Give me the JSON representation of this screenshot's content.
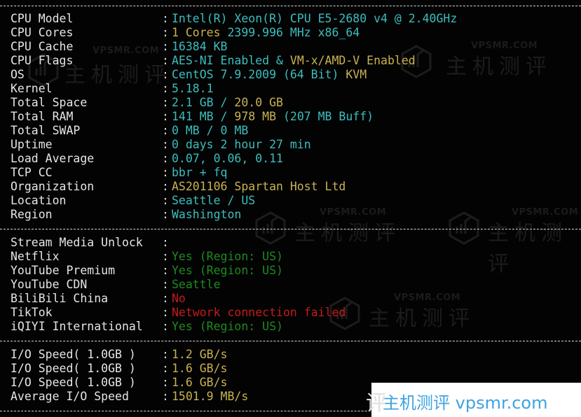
{
  "system_info": [
    {
      "label": "CPU Model",
      "segments": [
        {
          "text": "Intel(R) Xeon(R) CPU E5-2680 v4 @ 2.40GHz",
          "color": "cyan"
        }
      ]
    },
    {
      "label": "CPU Cores",
      "segments": [
        {
          "text": "1 Cores ",
          "color": "yellow"
        },
        {
          "text": "2399.996 MHz x86_64",
          "color": "cyan"
        }
      ]
    },
    {
      "label": "CPU Cache",
      "segments": [
        {
          "text": "16384 KB",
          "color": "cyan"
        }
      ]
    },
    {
      "label": "CPU Flags",
      "segments": [
        {
          "text": "AES-NI Enabled & ",
          "color": "cyan"
        },
        {
          "text": "VM-x/AMD-V Enabled",
          "color": "yellow"
        }
      ]
    },
    {
      "label": "OS",
      "segments": [
        {
          "text": "CentOS 7.9.2009 (64 Bit) ",
          "color": "cyan"
        },
        {
          "text": "KVM",
          "color": "yellow"
        }
      ]
    },
    {
      "label": "Kernel",
      "segments": [
        {
          "text": "5.18.1",
          "color": "cyan"
        }
      ]
    },
    {
      "label": "Total Space",
      "segments": [
        {
          "text": "2.1 GB / ",
          "color": "cyan"
        },
        {
          "text": "20.0 GB",
          "color": "yellow"
        }
      ]
    },
    {
      "label": "Total RAM",
      "segments": [
        {
          "text": "141 MB / ",
          "color": "cyan"
        },
        {
          "text": "978 MB",
          "color": "yellow"
        },
        {
          "text": " (207 MB Buff)",
          "color": "cyan"
        }
      ]
    },
    {
      "label": "Total SWAP",
      "segments": [
        {
          "text": "0 MB / 0 MB",
          "color": "cyan"
        }
      ]
    },
    {
      "label": "Uptime",
      "segments": [
        {
          "text": "0 days 2 hour 27 min",
          "color": "cyan"
        }
      ]
    },
    {
      "label": "Load Average",
      "segments": [
        {
          "text": "0.07, 0.06, 0.11",
          "color": "cyan"
        }
      ]
    },
    {
      "label": "TCP CC",
      "segments": [
        {
          "text": "bbr + fq",
          "color": "cyan"
        }
      ]
    },
    {
      "label": "Organization",
      "segments": [
        {
          "text": "AS201106 Spartan Host Ltd",
          "color": "yellow"
        }
      ]
    },
    {
      "label": "Location",
      "segments": [
        {
          "text": "Seattle / US",
          "color": "cyan"
        }
      ]
    },
    {
      "label": "Region",
      "segments": [
        {
          "text": "Washington",
          "color": "cyan"
        }
      ]
    }
  ],
  "stream_media": [
    {
      "label": "Stream Media Unlock",
      "segments": []
    },
    {
      "label": "Netflix",
      "segments": [
        {
          "text": "Yes (Region: US)",
          "color": "green"
        }
      ]
    },
    {
      "label": "YouTube Premium",
      "segments": [
        {
          "text": "Yes (Region: US)",
          "color": "green"
        }
      ]
    },
    {
      "label": "YouTube CDN",
      "segments": [
        {
          "text": "Seattle",
          "color": "green"
        }
      ]
    },
    {
      "label": "BiliBili China",
      "segments": [
        {
          "text": "No",
          "color": "red"
        }
      ]
    },
    {
      "label": "TikTok",
      "segments": [
        {
          "text": "Network connection failed",
          "color": "red"
        }
      ]
    },
    {
      "label": "iQIYI International",
      "segments": [
        {
          "text": "Yes (Region: US)",
          "color": "green"
        }
      ]
    }
  ],
  "io_speed": [
    {
      "label": "I/O Speed( 1.0GB )",
      "segments": [
        {
          "text": "1.2 GB/s",
          "color": "yellow"
        }
      ]
    },
    {
      "label": "I/O Speed( 1.0GB )",
      "segments": [
        {
          "text": "1.6 GB/s",
          "color": "yellow"
        }
      ]
    },
    {
      "label": "I/O Speed( 1.0GB )",
      "segments": [
        {
          "text": "1.6 GB/s",
          "color": "yellow"
        }
      ]
    },
    {
      "label": "Average I/O Speed",
      "segments": [
        {
          "text": "1501.9 MB/s",
          "color": "yellow"
        }
      ]
    }
  ],
  "separator_char": ":",
  "watermark": {
    "url": "VPSMR.COM",
    "cn": "主机测评"
  },
  "banner": {
    "text": "主机测评 vpsmr.com",
    "ghost": "评"
  },
  "colors": {
    "cyan": "#3dbdbd",
    "yellow": "#c9b251",
    "green": "#1f8a1f",
    "red": "#c41a1a",
    "banner_text": "#3ea3e0"
  }
}
